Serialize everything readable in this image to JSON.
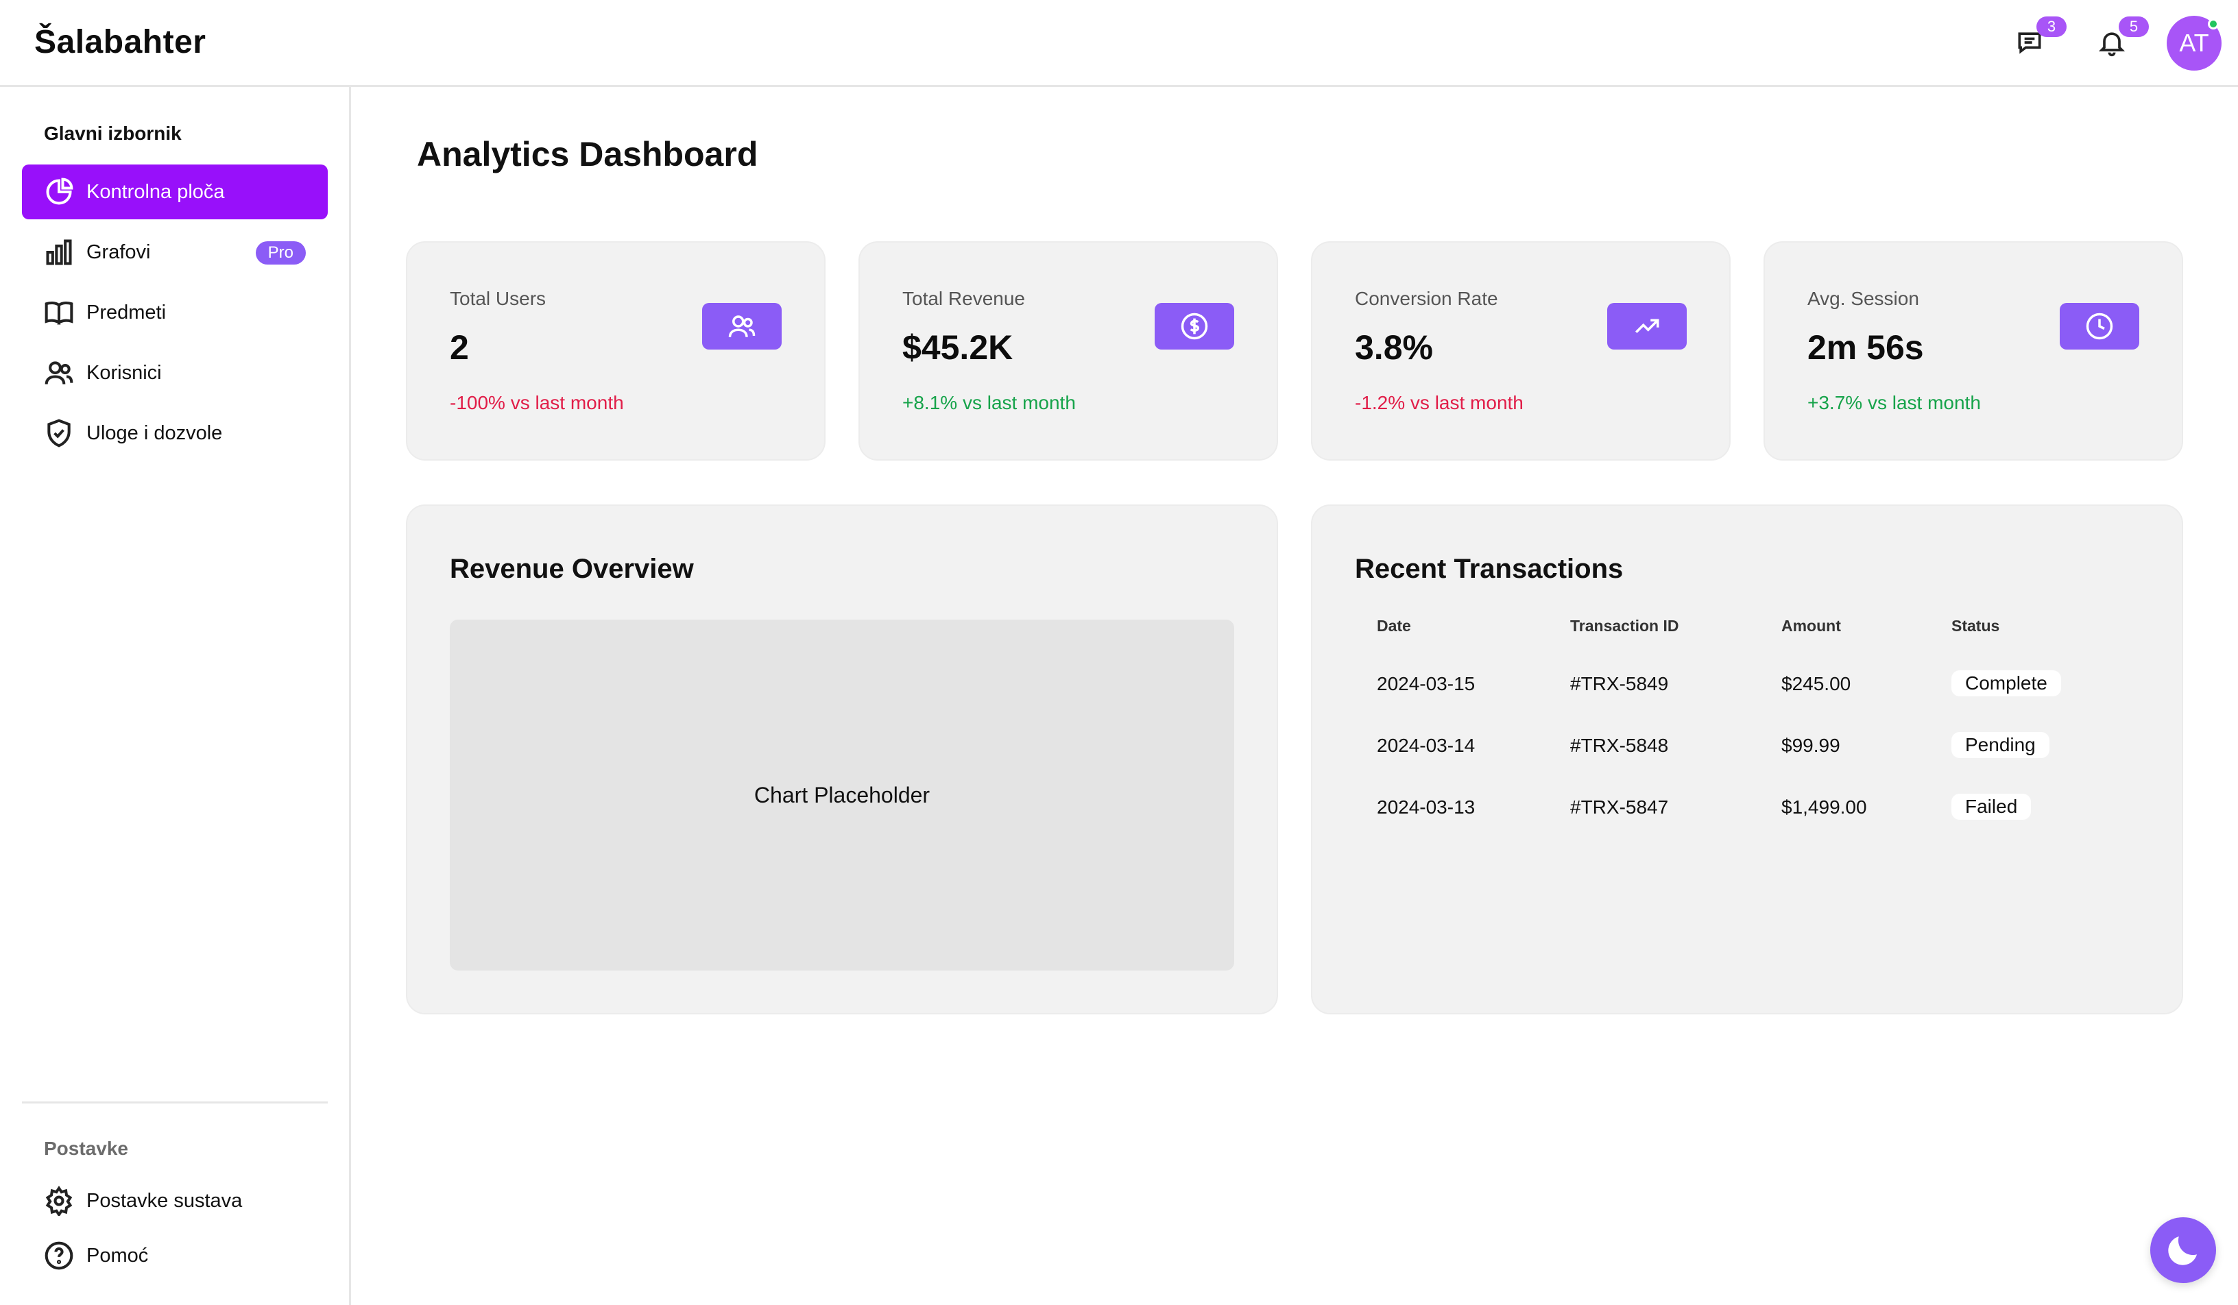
{
  "app": {
    "brand": "Šalabahter"
  },
  "header": {
    "messages_count": "3",
    "notifications_count": "5",
    "avatar_initials": "AT"
  },
  "sidebar": {
    "main_heading": "Glavni izbornik",
    "items": [
      {
        "label": "Kontrolna ploča",
        "icon": "pie-chart-icon",
        "active": true
      },
      {
        "label": "Grafovi",
        "icon": "bar-chart-icon",
        "badge": "Pro"
      },
      {
        "label": "Predmeti",
        "icon": "book-icon"
      },
      {
        "label": "Korisnici",
        "icon": "users-icon"
      },
      {
        "label": "Uloge i dozvole",
        "icon": "shield-check-icon"
      }
    ],
    "settings_heading": "Postavke",
    "settings_items": [
      {
        "label": "Postavke sustava",
        "icon": "gear-icon"
      },
      {
        "label": "Pomoć",
        "icon": "help-circle-icon"
      }
    ]
  },
  "main": {
    "title": "Analytics Dashboard",
    "stats": [
      {
        "label": "Total Users",
        "value": "2",
        "change": "-100% vs last month",
        "trend": "negative",
        "icon": "users-icon"
      },
      {
        "label": "Total Revenue",
        "value": "$45.2K",
        "change": "+8.1% vs last month",
        "trend": "positive",
        "icon": "dollar-circle-icon"
      },
      {
        "label": "Conversion Rate",
        "value": "3.8%",
        "change": "-1.2% vs last month",
        "trend": "negative",
        "icon": "trending-up-icon"
      },
      {
        "label": "Avg. Session",
        "value": "2m 56s",
        "change": "+3.7% vs last month",
        "trend": "positive",
        "icon": "clock-icon"
      }
    ],
    "revenue": {
      "title": "Revenue Overview",
      "placeholder": "Chart Placeholder"
    },
    "transactions": {
      "title": "Recent Transactions",
      "columns": [
        "Date",
        "Transaction ID",
        "Amount",
        "Status"
      ],
      "rows": [
        {
          "date": "2024-03-15",
          "id": "#TRX-5849",
          "amount": "$245.00",
          "status": "Complete"
        },
        {
          "date": "2024-03-14",
          "id": "#TRX-5848",
          "amount": "$99.99",
          "status": "Pending"
        },
        {
          "date": "2024-03-13",
          "id": "#TRX-5847",
          "amount": "$1,499.00",
          "status": "Failed"
        }
      ]
    }
  },
  "colors": {
    "accent": "#9810fa",
    "icon_bg": "#8b5cf6",
    "negative": "#e11d48",
    "positive": "#16a34a",
    "card_bg": "#f2f2f2"
  },
  "theme_toggle_icon": "moon-icon"
}
